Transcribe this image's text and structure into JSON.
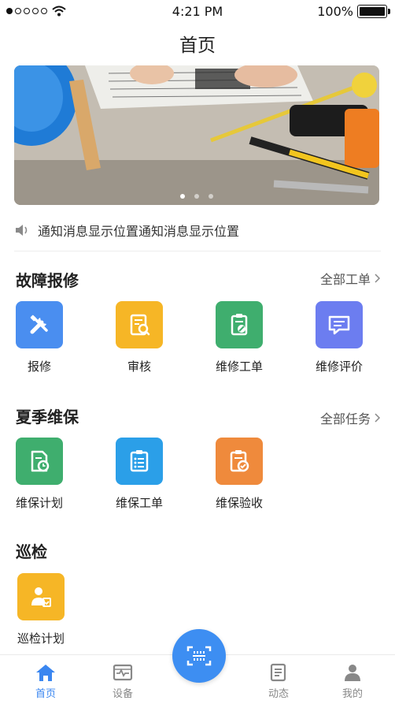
{
  "status_bar": {
    "time": "4:21 PM",
    "battery": "100%",
    "battery_level": 1.0
  },
  "header": {
    "title": "首页"
  },
  "banner": {
    "pages": 3,
    "active_page": 1
  },
  "notice": {
    "text": "通知消息显示位置通知消息显示位置",
    "icon": "speaker-icon"
  },
  "sections": {
    "repair": {
      "title": "故障报修",
      "more_label": "全部工单",
      "items": [
        {
          "label": "报修",
          "icon": "tools-icon",
          "color": "#4a8ef0"
        },
        {
          "label": "审核",
          "icon": "audit-search-icon",
          "color": "#f6b626"
        },
        {
          "label": "维修工单",
          "icon": "repair-order-icon",
          "color": "#3fae6e"
        },
        {
          "label": "维修评价",
          "icon": "comment-icon",
          "color": "#6c7df0"
        }
      ]
    },
    "maintenance": {
      "title": "夏季维保",
      "more_label": "全部任务",
      "items": [
        {
          "label": "维保计划",
          "icon": "plan-clock-icon",
          "color": "#3fae6e"
        },
        {
          "label": "维保工单",
          "icon": "clipboard-list-icon",
          "color": "#2b9fe8"
        },
        {
          "label": "维保验收",
          "icon": "clipboard-check-icon",
          "color": "#ef8a3c"
        }
      ]
    },
    "inspection": {
      "title": "巡检",
      "items": [
        {
          "label": "巡检计划",
          "icon": "inspector-icon",
          "color": "#f6b626"
        }
      ]
    }
  },
  "tabbar": {
    "tabs": [
      {
        "label": "首页",
        "icon": "home-icon",
        "active": true
      },
      {
        "label": "设备",
        "icon": "device-icon",
        "active": false
      },
      {
        "label": "动态",
        "icon": "news-icon",
        "active": false
      },
      {
        "label": "我的",
        "icon": "profile-icon",
        "active": false
      }
    ],
    "scan": {
      "icon": "scan-icon"
    }
  },
  "colors": {
    "accent": "#3d8ef2",
    "tab_inactive": "#888888"
  }
}
